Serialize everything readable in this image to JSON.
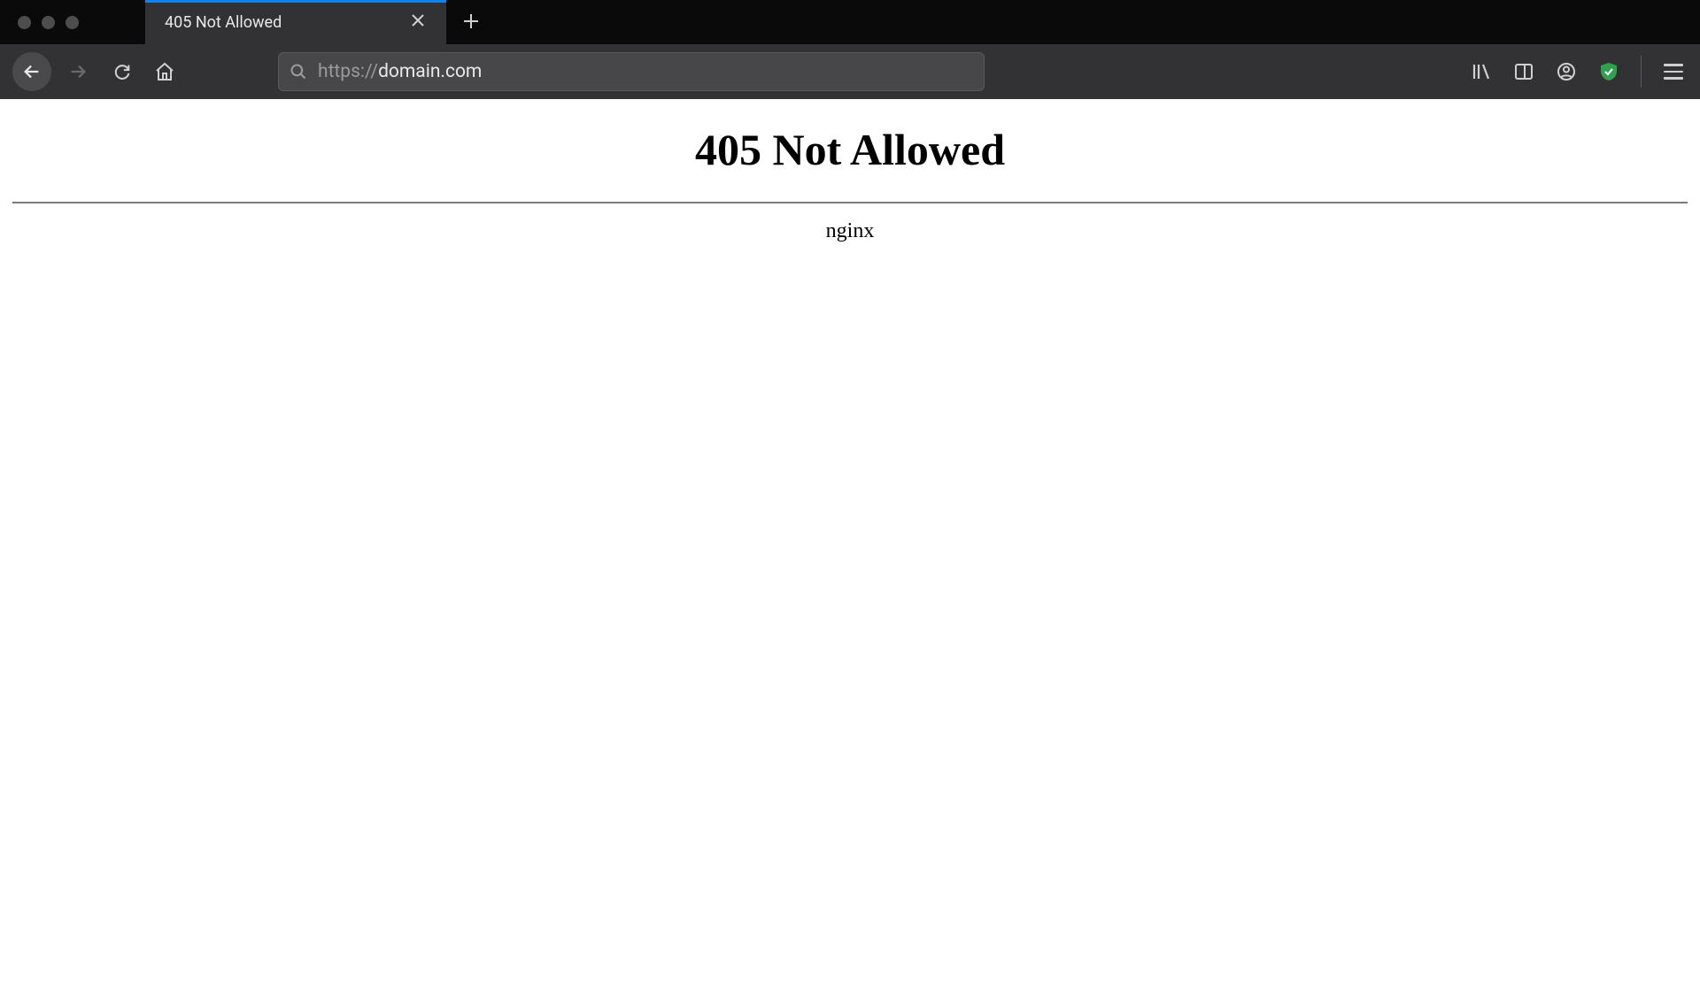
{
  "tab": {
    "title": "405 Not Allowed"
  },
  "address_bar": {
    "protocol": "https://",
    "host": "domain.com"
  },
  "page": {
    "heading": "405 Not Allowed",
    "server": "nginx"
  }
}
